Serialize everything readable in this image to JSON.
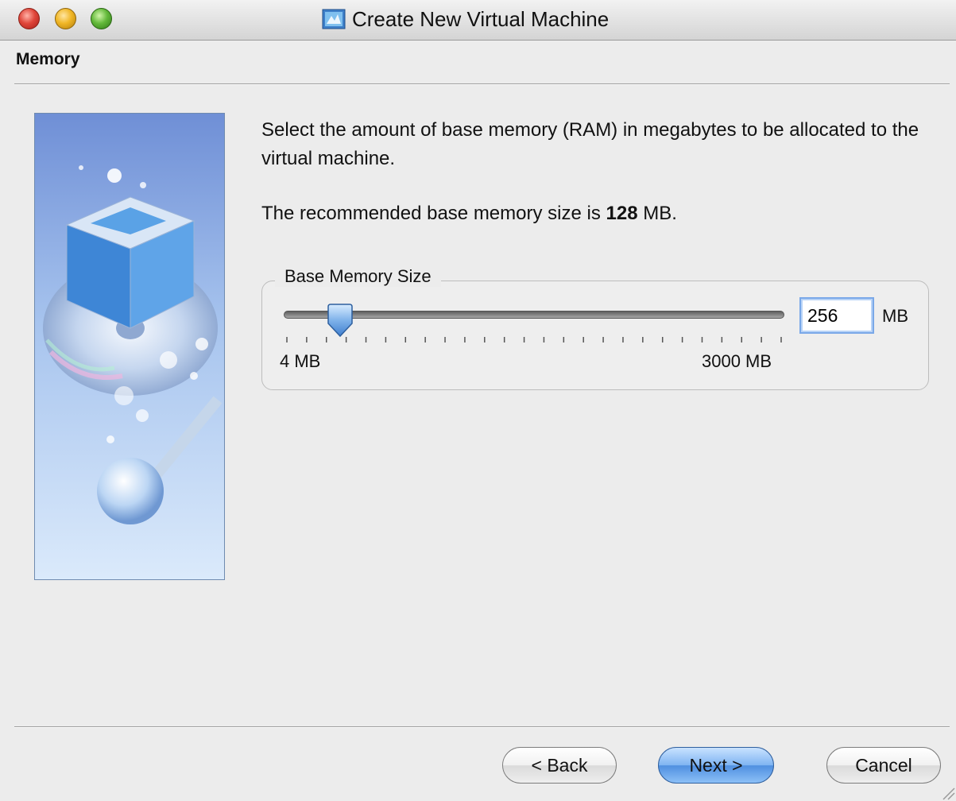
{
  "window": {
    "title": "Create New Virtual Machine",
    "app_icon": "virtualbox-icon"
  },
  "page": {
    "header": "Memory",
    "description": "Select the amount of base memory (RAM) in megabytes to be allocated to the virtual machine.",
    "recommendation_prefix": "The recommended base memory size is ",
    "recommendation_value": "128",
    "recommendation_suffix": " MB."
  },
  "memory": {
    "group_title": "Base Memory Size",
    "value": "256",
    "unit": "MB",
    "slider_value": 256,
    "min_label": "4 MB",
    "max_label": "3000 MB",
    "min_value": 4,
    "max_value": 3000
  },
  "buttons": {
    "back": "< Back",
    "next": "Next >",
    "cancel": "Cancel"
  },
  "colors": {
    "window_bg": "#ececec",
    "default_button": "#5a9be6",
    "focus_ring": "#7aa8e8"
  }
}
